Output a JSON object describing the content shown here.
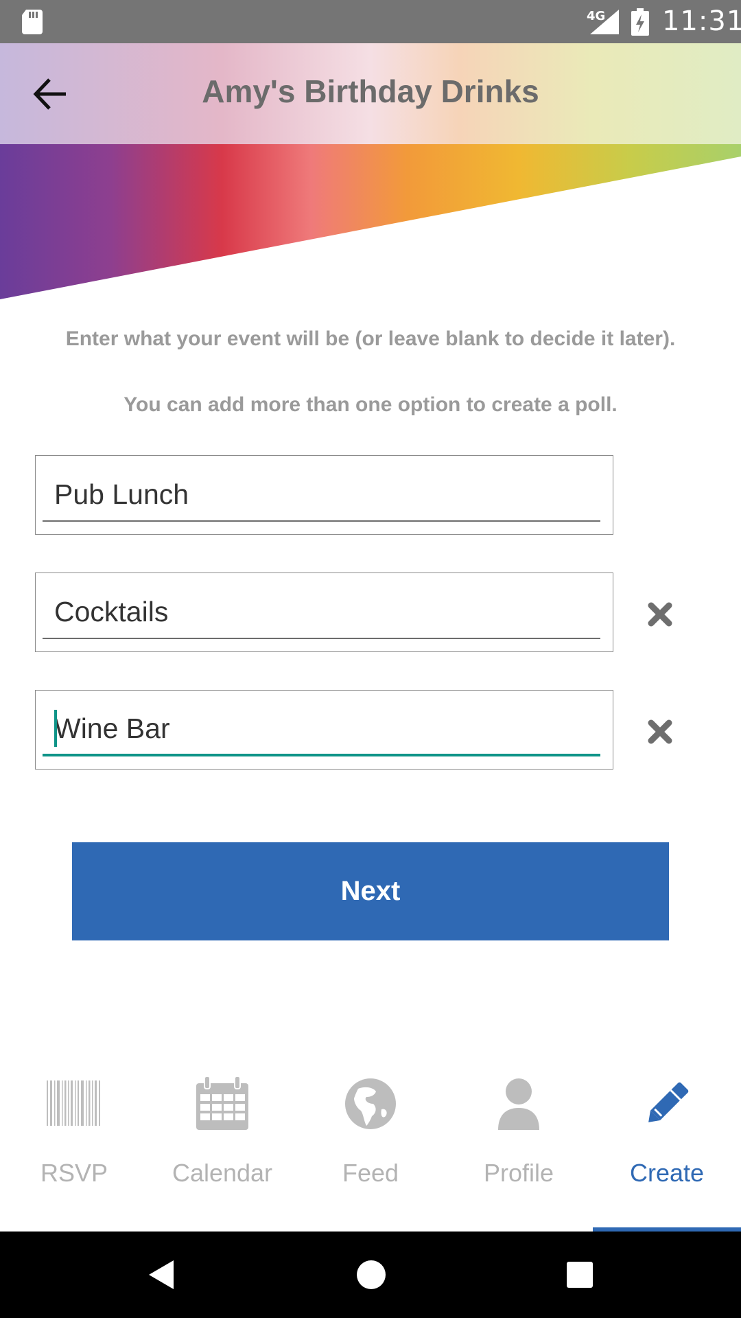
{
  "status_bar": {
    "network": "4G",
    "time": "11:31"
  },
  "header": {
    "title": "Amy's Birthday Drinks"
  },
  "instructions": {
    "line1": "Enter what your event will be (or leave blank to decide it later).",
    "line2": "You can add more than one option to create a poll."
  },
  "options": [
    {
      "value": "Pub Lunch",
      "removable": false
    },
    {
      "value": "Cocktails",
      "removable": true
    },
    {
      "value": "Wine Bar",
      "removable": true,
      "focused": true
    }
  ],
  "next_button": {
    "label": "Next"
  },
  "bottom_nav": {
    "items": [
      {
        "label": "RSVP",
        "icon": "barcode-icon"
      },
      {
        "label": "Calendar",
        "icon": "calendar-icon"
      },
      {
        "label": "Feed",
        "icon": "globe-icon"
      },
      {
        "label": "Profile",
        "icon": "person-icon"
      },
      {
        "label": "Create",
        "icon": "pencil-icon",
        "active": true
      }
    ]
  },
  "colors": {
    "accent": "#2f69b4",
    "focus": "#0f9488",
    "inactive_nav": "#b3b3b3",
    "status_bar": "#757575"
  }
}
